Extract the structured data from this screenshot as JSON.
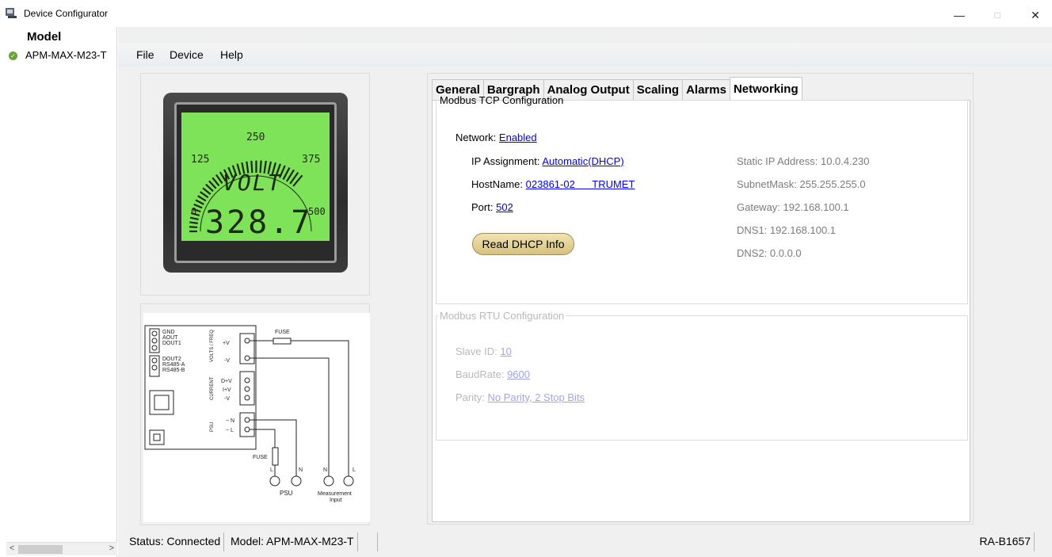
{
  "window": {
    "title": "Device Configurator",
    "minimize": "—",
    "maximize": "□",
    "close": "✕"
  },
  "sidebar": {
    "header": "Model",
    "items": [
      {
        "label": "APM-MAX-M23-T",
        "status_icon": "check-circle-icon",
        "status_color": "#6aa531"
      }
    ],
    "scroll_left": "<",
    "scroll_right": ">"
  },
  "menu": {
    "items": [
      {
        "label": "File"
      },
      {
        "label": "Device"
      },
      {
        "label": "Help"
      }
    ]
  },
  "device_display": {
    "scale_top": "250",
    "scale_left": "125",
    "scale_right": "375",
    "scale_min": "0",
    "scale_max": "500",
    "unit": "VOLT",
    "reading": "328.7",
    "backlight_color": "#7fe35a"
  },
  "wiring": {
    "terminals_left": [
      "GND",
      "AOUT",
      "DOUT1",
      "DOUT2",
      "RS485-A",
      "RS485-B"
    ],
    "label_volts": "VOLTS / FREQ",
    "label_current": "CURRENT",
    "label_psu": "PSU",
    "pin_plus_v": "+V",
    "pin_minus_v": "-V",
    "pin_d_plus_v": "D+V",
    "pin_i_plus_v": "I+V",
    "pin_minus_v2": "-V",
    "pin_n": "~ N",
    "pin_l": "~ L",
    "fuse_top": "FUSE",
    "fuse_bottom": "FUSE",
    "psu_l": "L",
    "psu_n": "N",
    "meas_n": "N",
    "meas_l": "L",
    "psu_caption": "PSU",
    "meas_caption_1": "Measurement",
    "meas_caption_2": "Input"
  },
  "tabs": [
    {
      "label": "General",
      "active": false
    },
    {
      "label": "Bargraph",
      "active": false
    },
    {
      "label": "Analog Output",
      "active": false
    },
    {
      "label": "Scaling",
      "active": false
    },
    {
      "label": "Alarms",
      "active": false
    },
    {
      "label": "Networking",
      "active": true
    }
  ],
  "tcp": {
    "legend": "Modbus TCP Configuration",
    "network_label": "Network:",
    "network_value": "Enabled",
    "ip_assignment_label": "IP Assignment:",
    "ip_assignment_value": "Automatic(DHCP)",
    "hostname_label": "HostName:",
    "hostname_value": "023861-02      TRUMET",
    "port_label": "Port:",
    "port_value": "502",
    "dhcp_button": "Read DHCP Info",
    "static_ip": "Static IP Address: 10.0.4.230",
    "subnet": "SubnetMask: 255.255.255.0",
    "gateway": "Gateway: 192.168.100.1",
    "dns1": "DNS1: 192.168.100.1",
    "dns2": "DNS2: 0.0.0.0"
  },
  "rtu": {
    "legend": "Modbus RTU Configuration",
    "slave_label": "Slave ID:",
    "slave_value": "10",
    "baud_label": "BaudRate:",
    "baud_value": "9600",
    "parity_label": "Parity:",
    "parity_value": "No Parity, 2 Stop Bits"
  },
  "status": {
    "connection": "Status: Connected",
    "model": "Model: APM-MAX-M23-T",
    "code": "RA-B1657"
  }
}
